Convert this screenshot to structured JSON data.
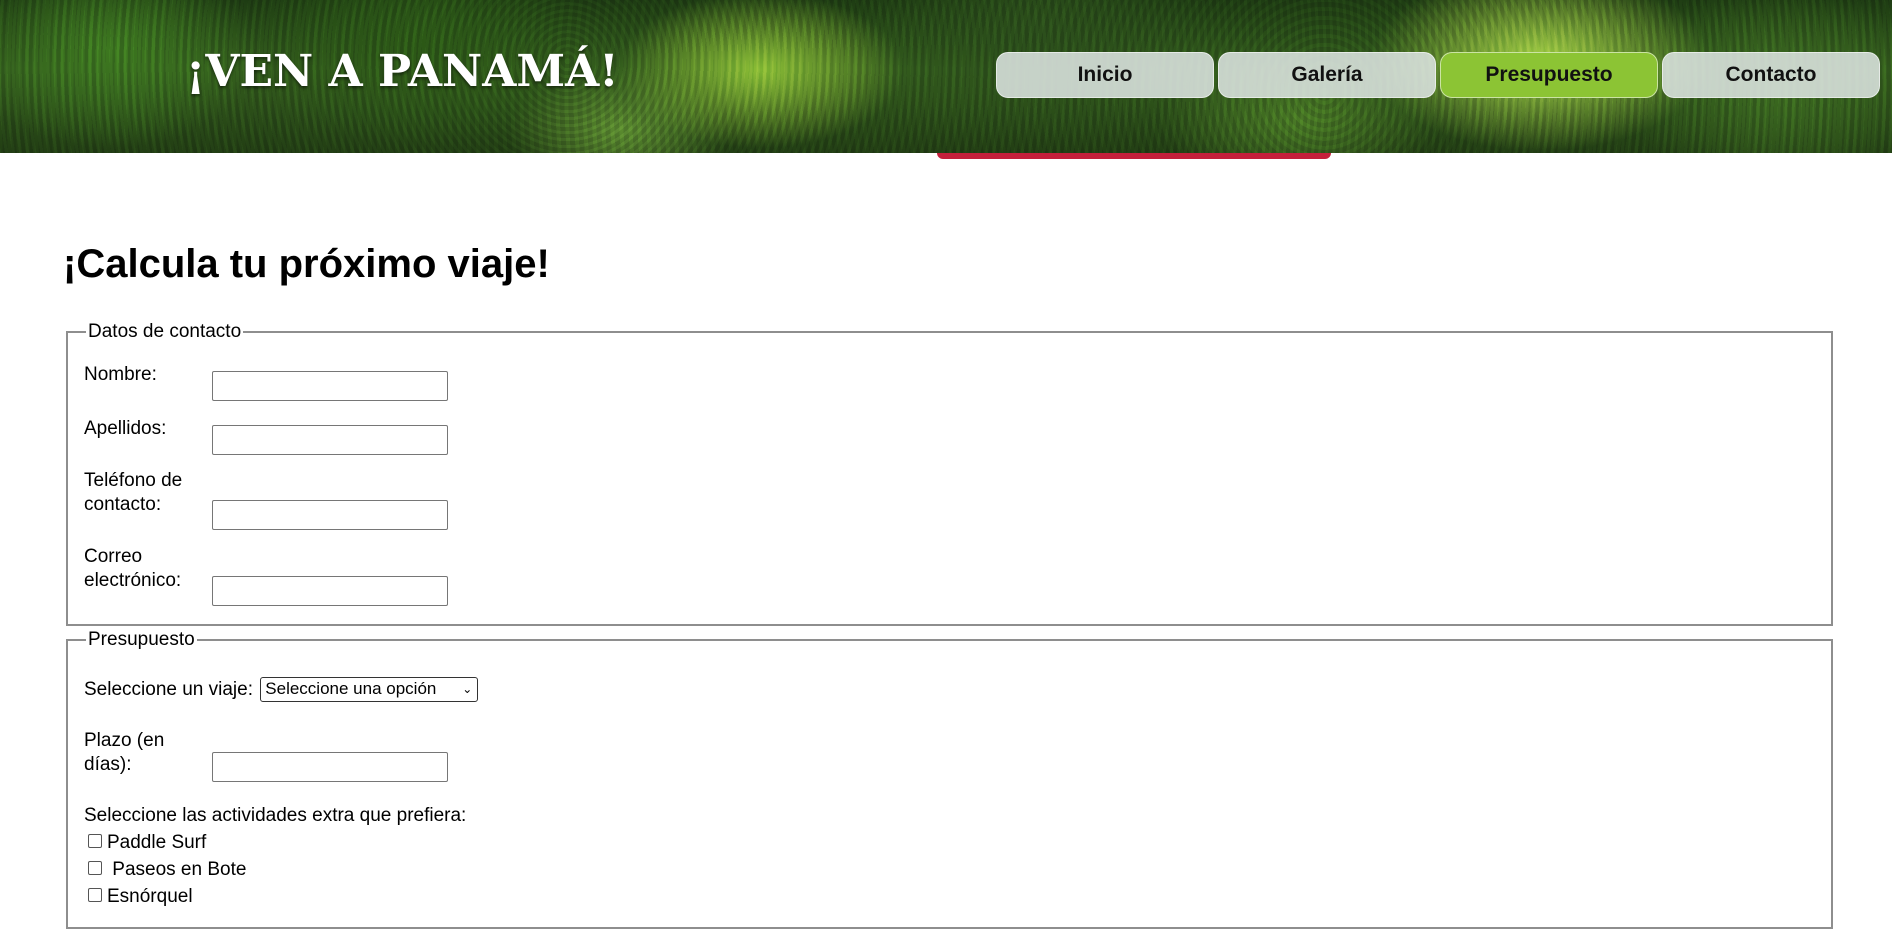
{
  "header": {
    "site_title": "¡VEN A PANAMÁ!",
    "nav": [
      {
        "label": "Inicio",
        "active": false
      },
      {
        "label": "Galería",
        "active": false
      },
      {
        "label": "Presupuesto",
        "active": true
      },
      {
        "label": "Contacto",
        "active": false
      }
    ]
  },
  "main": {
    "page_title": "¡Calcula tu próximo viaje!",
    "contact_section": {
      "legend": "Datos de contacto",
      "fields": [
        {
          "label": "Nombre:",
          "value": ""
        },
        {
          "label": "Apellidos:",
          "value": ""
        },
        {
          "label_line1": "Teléfono de",
          "label_line2": "contacto:",
          "value": ""
        },
        {
          "label_line1": "Correo",
          "label_line2": "electrónico:",
          "value": ""
        }
      ]
    },
    "budget_section": {
      "legend": "Presupuesto",
      "trip_select_label": "Seleccione un viaje:",
      "trip_select_value": "Seleccione una opción",
      "days_label_line1": "Plazo (en",
      "days_label_line2": "días):",
      "days_value": "",
      "extras_label": "Seleccione las actividades extra que prefiera:",
      "extras": [
        {
          "label": "Paddle Surf",
          "checked": false
        },
        {
          "label": " Paseos en Bote",
          "checked": false
        },
        {
          "label": "Esnórquel",
          "checked": false
        }
      ]
    }
  },
  "colors": {
    "nav_active": "#8cc434",
    "nav_default": "#dce4e0",
    "accent_red": "#c41f3b",
    "fieldset_border": "#8e8e8e"
  },
  "icons": {
    "select_arrow": "chevron-down-icon"
  }
}
